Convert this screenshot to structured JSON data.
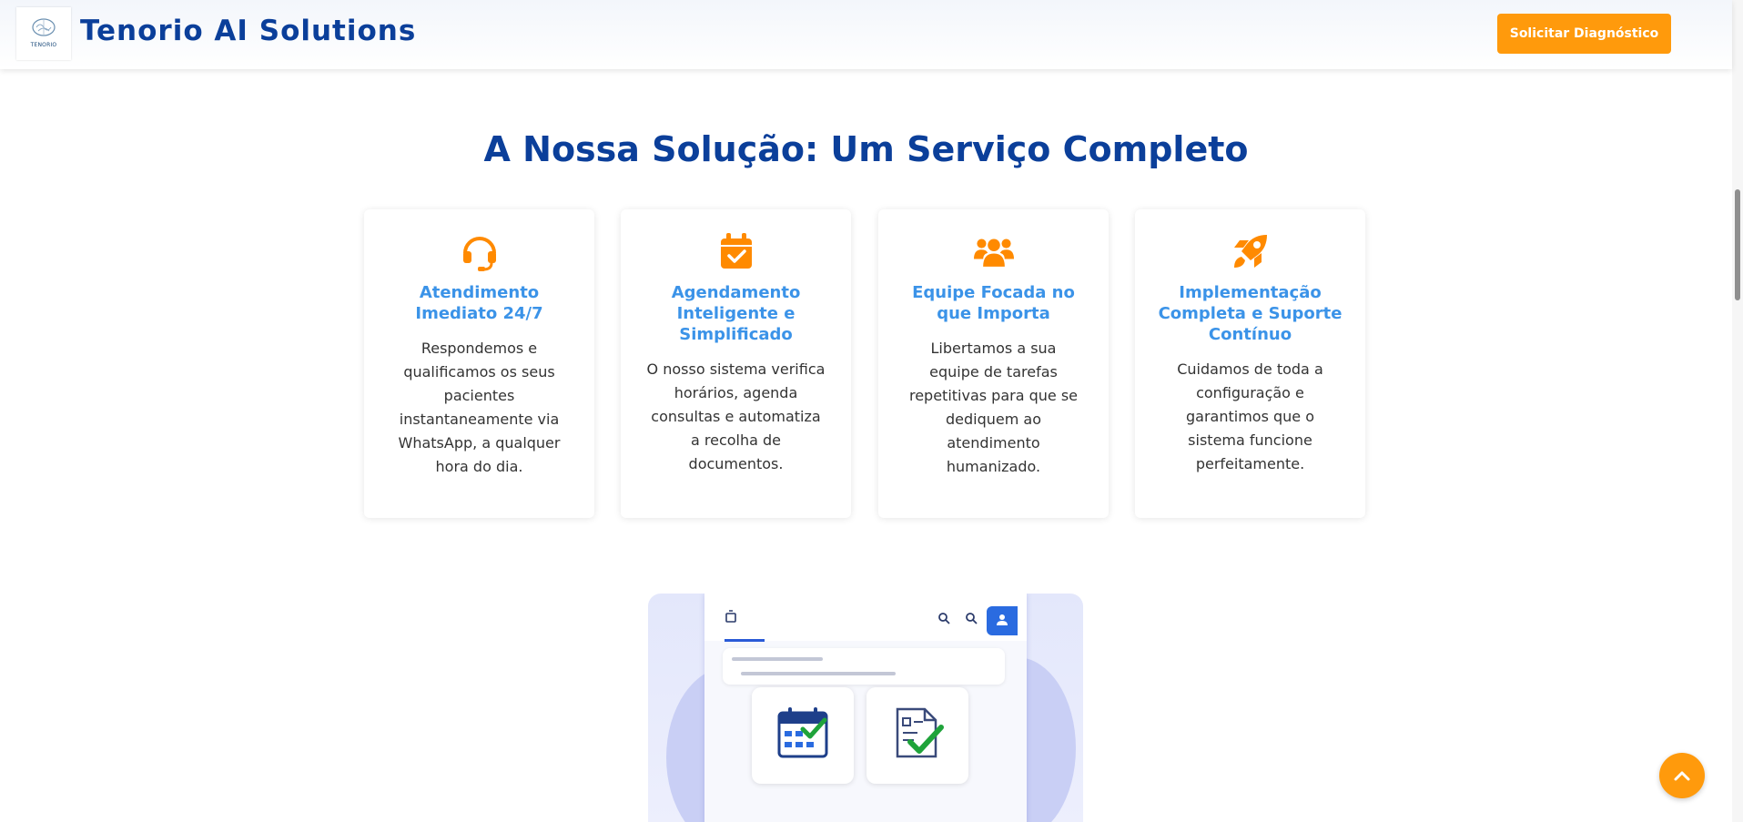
{
  "header": {
    "logo_text": "TENORIO",
    "brand": "Tenorio AI Solutions",
    "cta_label": "Solicitar Diagnóstico"
  },
  "section": {
    "title": "A Nossa Solução: Um Serviço Completo"
  },
  "cards": [
    {
      "icon": "headset-icon",
      "title": "Atendimento Imediato 24/7",
      "text": "Respondemos e qualificamos os seus pacientes instantaneamente via WhatsApp, a qualquer hora do dia."
    },
    {
      "icon": "calendar-check-icon",
      "title": "Agendamento Inteligente e Simplificado",
      "text": "O nosso sistema verifica horários, agenda consultas e automatiza a recolha de documentos."
    },
    {
      "icon": "users-icon",
      "title": "Equipe Focada no que Importa",
      "text": "Libertamos a sua equipe de tarefas repetitivas para que se dediquem ao atendimento humanizado."
    },
    {
      "icon": "rocket-icon",
      "title": "Implementação Completa e Suporte Contínuo",
      "text": "Cuidamos de toda a configuração e garantimos que o sistema funcione perfeitamente."
    }
  ],
  "colors": {
    "primary": "#0b3f9a",
    "accent": "#ff9a0c",
    "card_title": "#3b93e8"
  }
}
